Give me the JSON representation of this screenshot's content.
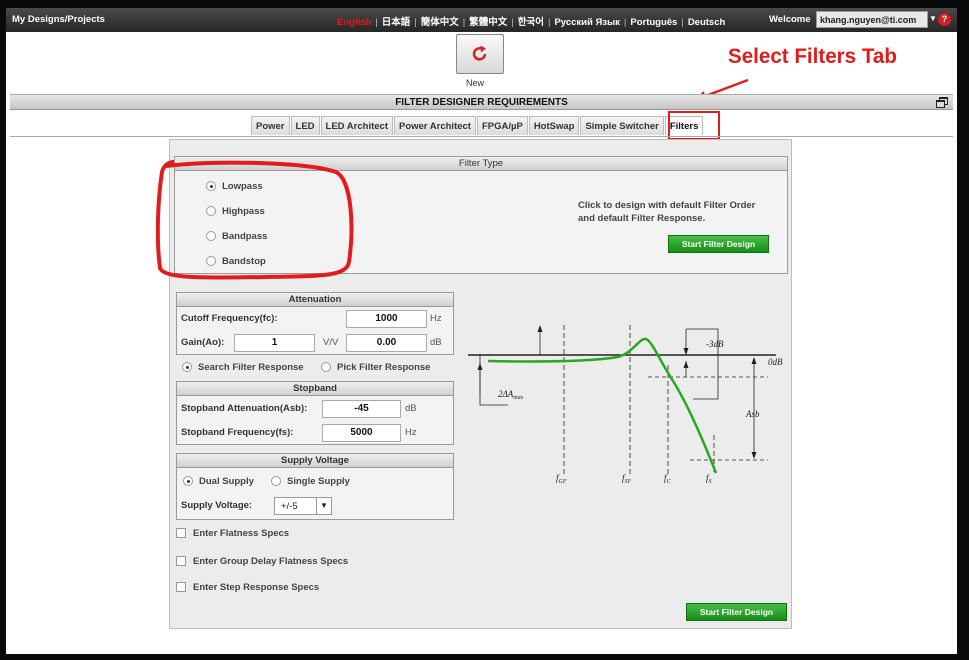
{
  "topbar": {
    "brand": "My Designs/Projects",
    "languages": [
      {
        "label": "English",
        "active": true
      },
      {
        "label": "日本語",
        "active": false
      },
      {
        "label": "簡体中文",
        "active": false
      },
      {
        "label": "繁體中文",
        "active": false
      },
      {
        "label": "한국어",
        "active": false
      },
      {
        "label": "Русский Язык",
        "active": false
      },
      {
        "label": "Português",
        "active": false
      },
      {
        "label": "Deutsch",
        "active": false
      }
    ],
    "welcome": "Welcome",
    "user": "khang.nguyen@ti.com",
    "help": "?"
  },
  "toolbar": {
    "new_label": "New"
  },
  "annotation": {
    "text": "Select Filters Tab"
  },
  "title": "FILTER DESIGNER REQUIREMENTS",
  "tabs": [
    "Power",
    "LED",
    "LED Architect",
    "Power Architect",
    "FPGA/µP",
    "HotSwap",
    "Simple Switcher",
    "Filters"
  ],
  "selected_tab": "Filters",
  "filter_type": {
    "header": "Filter Type",
    "options": [
      "Lowpass",
      "Highpass",
      "Bandpass",
      "Bandstop"
    ],
    "selected": "Lowpass",
    "hint": "Click to design with default Filter Order and default Filter Response.",
    "hint_line1": "Click to design with default Filter Order",
    "hint_line2": "and default Filter Response.",
    "start_button": "Start Filter Design"
  },
  "attenuation": {
    "header": "Attenuation",
    "cutoff_label": "Cutoff Frequency(fc):",
    "cutoff_value": "1000",
    "cutoff_unit": "Hz",
    "gain_label": "Gain(Ao):",
    "gain_value": "1",
    "gain_unit": "V/V",
    "gain_db_value": "0.00",
    "gain_db_unit": "dB"
  },
  "response": {
    "options": [
      "Search Filter Response",
      "Pick Filter Response"
    ],
    "selected": "Search Filter Response"
  },
  "stopband": {
    "header": "Stopband",
    "atten_label": "Stopband Attenuation(Asb):",
    "atten_value": "-45",
    "atten_unit": "dB",
    "freq_label": "Stopband Frequency(fs):",
    "freq_value": "5000",
    "freq_unit": "Hz"
  },
  "supply": {
    "header": "Supply Voltage",
    "options": [
      "Dual Supply",
      "Single Supply"
    ],
    "selected": "Dual Supply",
    "voltage_label": "Supply Voltage:",
    "voltage_value": "+/-5"
  },
  "specs": [
    "Enter Flatness Specs",
    "Enter Group Delay Flatness Specs",
    "Enter Step Response Specs"
  ],
  "bottom_button": "Start Filter Design",
  "diagram": {
    "labels": {
      "minus3db": "-3dB",
      "zero_db": "0dB",
      "ripple": "2ΔA",
      "ripple_sub": "max",
      "asb": "Asb",
      "fgf": "f",
      "fgf_sub": "GF",
      "fsf": "f",
      "fsf_sub": "SF",
      "fc": "f",
      "fc_sub": "C",
      "fs": "f",
      "fs_sub": "S"
    },
    "colors": {
      "response_curve": "#22aa22"
    }
  }
}
